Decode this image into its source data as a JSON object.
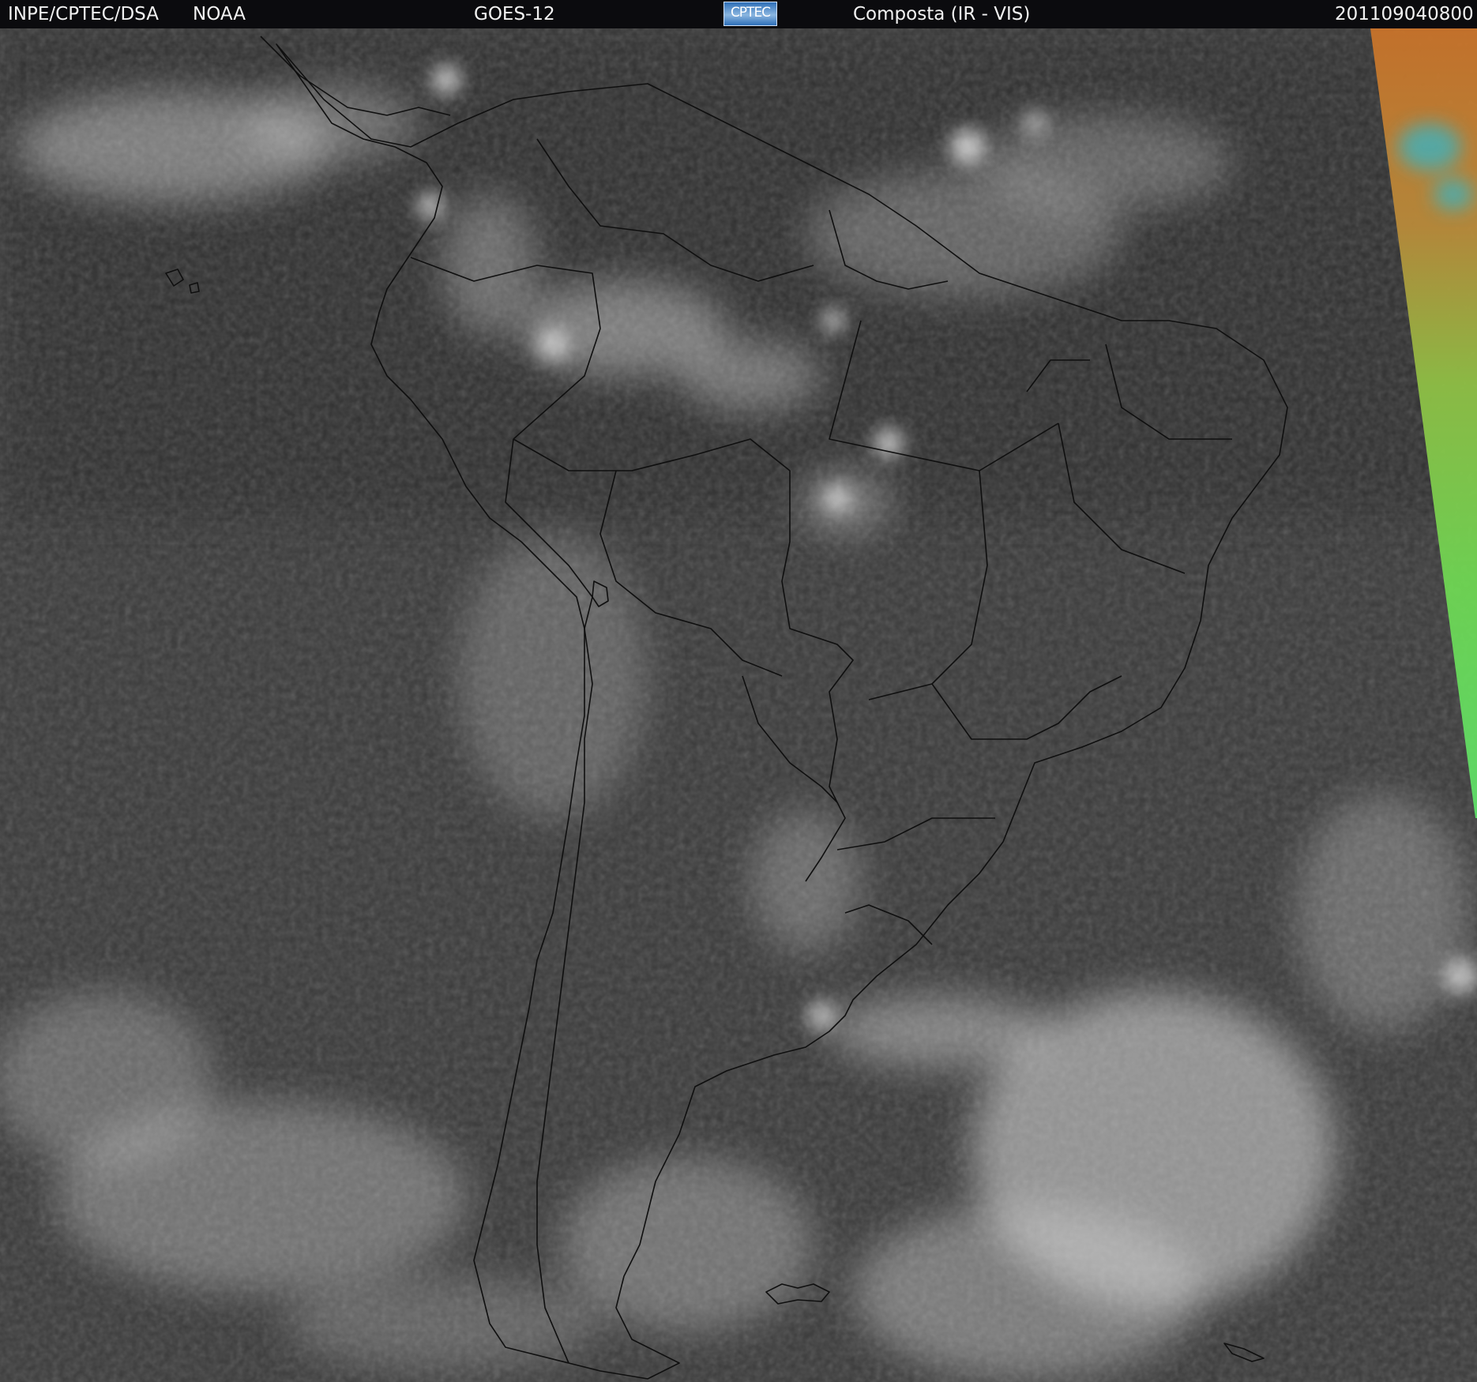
{
  "header": {
    "agency": "INPE/CPTEC/DSA",
    "source": "NOAA",
    "satellite": "GOES-12",
    "logo_text": "CPTEC",
    "product": "Composta (IR - VIS)",
    "timestamp": "201109040800"
  },
  "colors": {
    "bar_background": "#0b0b0e",
    "bar_text": "#f2f2f2",
    "background_gray": "#3a3a3a",
    "coastline": "#0f0f0f",
    "cloud": "#d8d8d8",
    "color_strip": [
      "#c9732a",
      "#7ad84e",
      "#34b6c8"
    ]
  },
  "image": {
    "type": "satellite-composite",
    "region": "South America",
    "overlay": "political borders and coastlines"
  }
}
